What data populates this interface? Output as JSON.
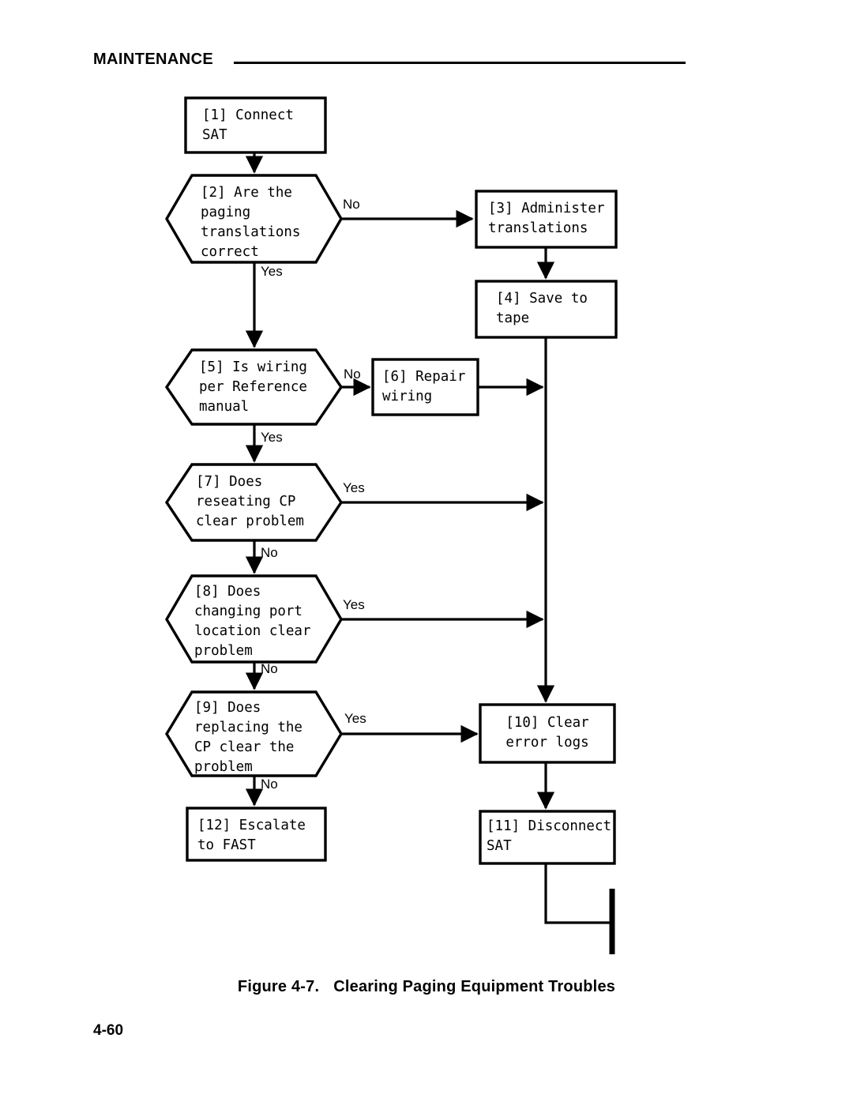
{
  "header": {
    "title": "MAINTENANCE"
  },
  "figure": {
    "caption_number": "Figure 4-7.",
    "caption_title": "Clearing Paging Equipment Troubles",
    "page_number": "4-60"
  },
  "flowchart": {
    "type": "flowchart",
    "nodes": [
      {
        "id": "1",
        "shape": "process",
        "text": "[1] Connect\nSAT",
        "align": "left"
      },
      {
        "id": "2",
        "shape": "decision",
        "text": "[2] Are the\npaging\ntranslations\ncorrect",
        "align": "left"
      },
      {
        "id": "3",
        "shape": "process",
        "text": "[3] Administer\ntranslations",
        "align": "left"
      },
      {
        "id": "4",
        "shape": "process",
        "text": "[4] Save to\ntape",
        "align": "left"
      },
      {
        "id": "5",
        "shape": "decision",
        "text": "[5] Is wiring\nper Reference\nmanual",
        "align": "left"
      },
      {
        "id": "6",
        "shape": "process",
        "text": "[6] Repair\nwiring",
        "align": "left"
      },
      {
        "id": "7",
        "shape": "decision",
        "text": "[7] Does\nreseating CP\nclear problem",
        "align": "left"
      },
      {
        "id": "8",
        "shape": "decision",
        "text": "[8] Does\nchanging port\nlocation clear\nproblem",
        "align": "left"
      },
      {
        "id": "9",
        "shape": "decision",
        "text": "[9] Does\nreplacing the\nCP clear the\nproblem",
        "align": "left"
      },
      {
        "id": "10",
        "shape": "process",
        "text": "[10] Clear\nerror logs",
        "align": "center"
      },
      {
        "id": "11",
        "shape": "process",
        "text": "[11] Disconnect\nSAT",
        "align": "left"
      },
      {
        "id": "12",
        "shape": "process",
        "text": "[12] Escalate\nto FAST",
        "align": "left"
      }
    ],
    "edges": [
      {
        "from": "1",
        "to": "2",
        "label": ""
      },
      {
        "from": "2",
        "to": "3",
        "label": "No"
      },
      {
        "from": "2",
        "to": "5",
        "label": "Yes"
      },
      {
        "from": "3",
        "to": "4",
        "label": ""
      },
      {
        "from": "4",
        "to": "10",
        "label": ""
      },
      {
        "from": "5",
        "to": "6",
        "label": "No"
      },
      {
        "from": "5",
        "to": "7",
        "label": "Yes"
      },
      {
        "from": "6",
        "to": "10",
        "label": ""
      },
      {
        "from": "7",
        "to": "10",
        "label": "Yes"
      },
      {
        "from": "7",
        "to": "8",
        "label": "No"
      },
      {
        "from": "8",
        "to": "10",
        "label": "Yes"
      },
      {
        "from": "8",
        "to": "9",
        "label": "No"
      },
      {
        "from": "9",
        "to": "10",
        "label": "Yes"
      },
      {
        "from": "9",
        "to": "12",
        "label": "No"
      },
      {
        "from": "10",
        "to": "11",
        "label": ""
      },
      {
        "from": "11",
        "to": "end",
        "label": ""
      }
    ],
    "edge_labels": {
      "e2_no": "No",
      "e2_yes": "Yes",
      "e5_no": "No",
      "e5_yes": "Yes",
      "e7_yes": "Yes",
      "e7_no": "No",
      "e8_yes": "Yes",
      "e8_no": "No",
      "e9_yes": "Yes",
      "e9_no": "No"
    }
  },
  "colors": {
    "ink": "#000000",
    "paper": "#ffffff"
  }
}
